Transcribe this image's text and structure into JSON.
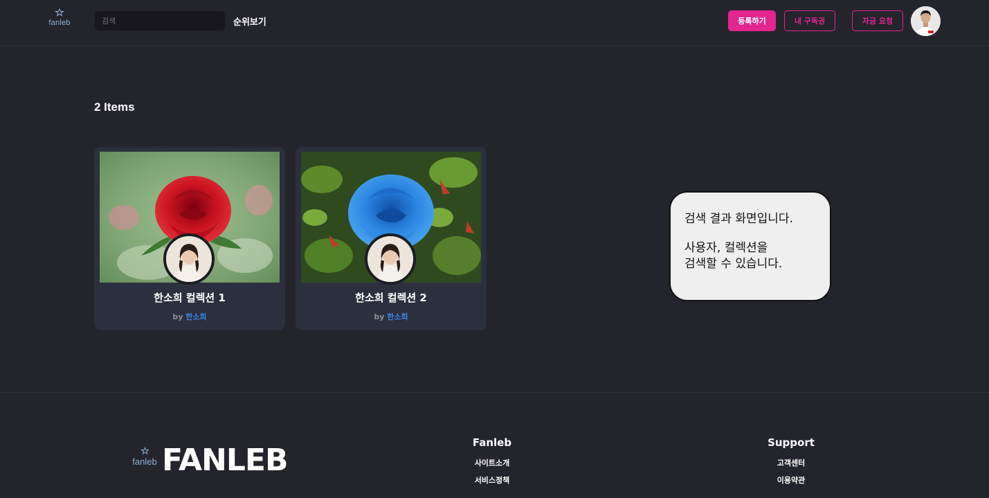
{
  "header": {
    "logo_text": "fanleb",
    "search_placeholder": "검색",
    "rank_link": "순위보기",
    "register_button": "등록하기",
    "subscription_button": "내 구독권",
    "funding_button": "자금 요청"
  },
  "main": {
    "items_count": "2 Items",
    "cards": [
      {
        "title": "한소희 컬렉션 1",
        "by_label": "by",
        "author": "한소희"
      },
      {
        "title": "한소희 컬렉션 2",
        "by_label": "by",
        "author": "한소희"
      }
    ]
  },
  "bubble": {
    "line1": "검색 결과 화면입니다.",
    "line2": "사용자, 컬렉션을",
    "line3": "검색할 수 있습니다."
  },
  "footer": {
    "logo_text": "fanleb",
    "brand": "FANLEB",
    "col_fanleb": {
      "title": "Fanleb",
      "links": [
        "사이트소개",
        "서비스정책"
      ]
    },
    "col_support": {
      "title": "Support",
      "links": [
        "고객센터",
        "이용약관"
      ]
    }
  },
  "colors": {
    "background": "#24242d",
    "accent": "#e3268f",
    "card_bg": "#2c2f3d",
    "author_link": "#3b82e8"
  }
}
